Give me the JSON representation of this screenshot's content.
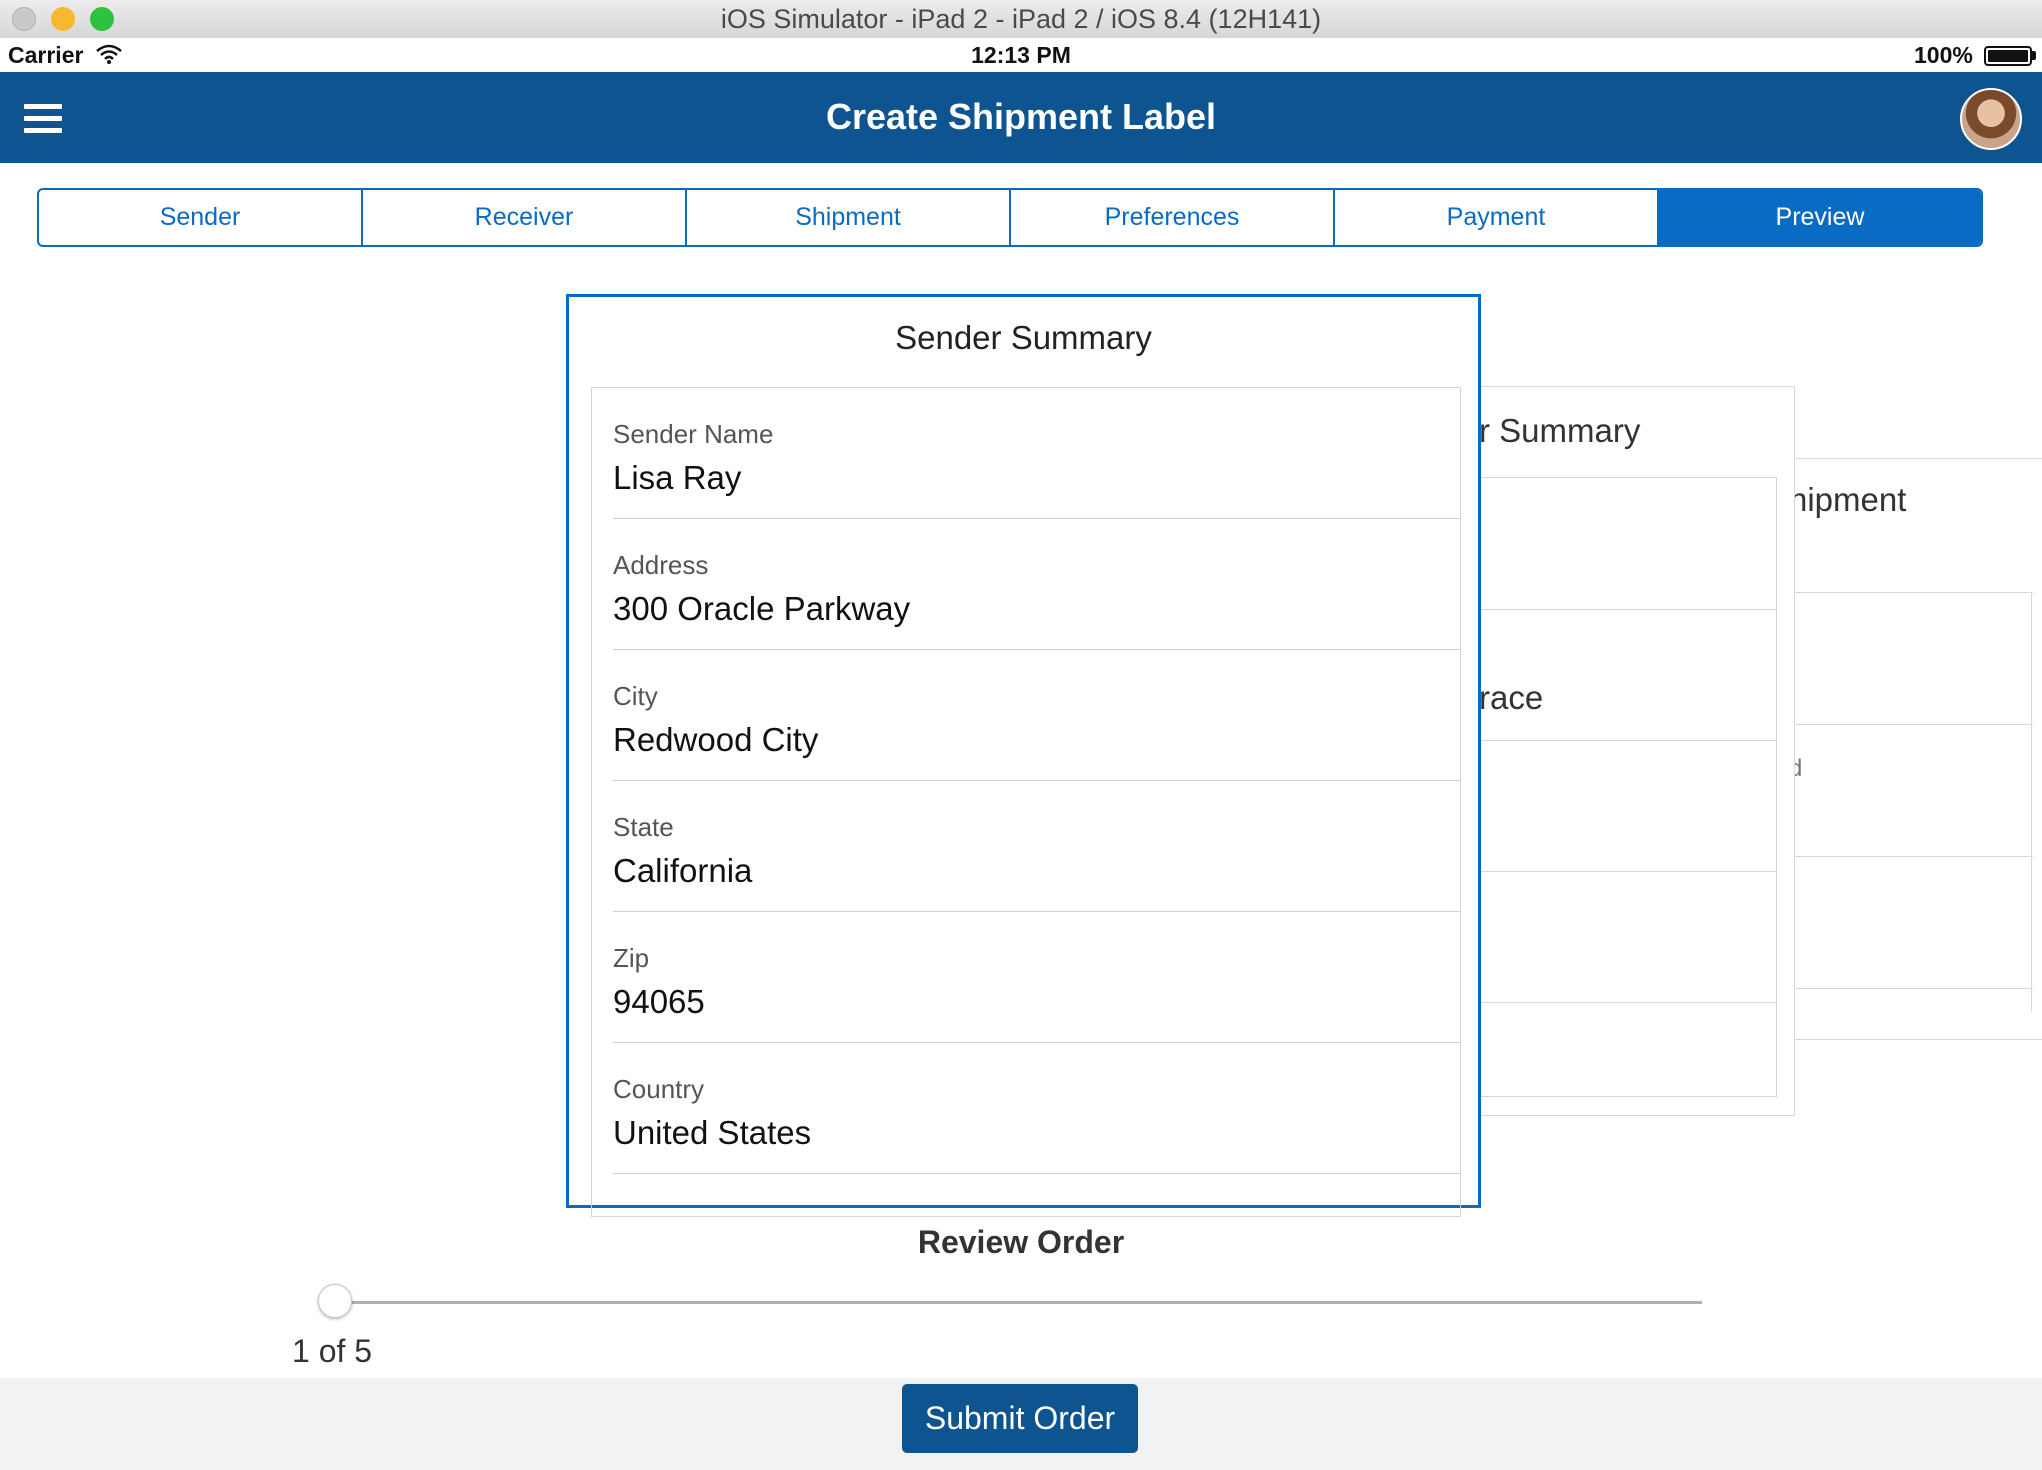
{
  "window": {
    "title": "iOS Simulator - iPad 2 - iPad 2 / iOS 8.4 (12H141)"
  },
  "status": {
    "carrier": "Carrier",
    "time": "12:13 PM",
    "battery": "100%"
  },
  "header": {
    "title": "Create Shipment Label"
  },
  "tabs": [
    {
      "label": "Sender"
    },
    {
      "label": "Receiver"
    },
    {
      "label": "Shipment"
    },
    {
      "label": "Preferences"
    },
    {
      "label": "Payment"
    },
    {
      "label": "Preview"
    }
  ],
  "front_card": {
    "title": "Sender Summary",
    "fields": [
      {
        "label": "Sender Name",
        "value": "Lisa Ray"
      },
      {
        "label": "Address",
        "value": "300 Oracle Parkway"
      },
      {
        "label": "City",
        "value": "Redwood City"
      },
      {
        "label": "State",
        "value": "California"
      },
      {
        "label": "Zip",
        "value": "94065"
      },
      {
        "label": "Country",
        "value": "United States"
      }
    ]
  },
  "back_card_1": {
    "title_fragment": "r Summary",
    "value_fragment": "race"
  },
  "back_card_2": {
    "title_fragment": "nipment",
    "value_fragment": "d"
  },
  "review": {
    "heading": "Review Order",
    "counter": "1 of 5",
    "progress": 0.0
  },
  "actions": {
    "submit_label": "Submit Order"
  },
  "colors": {
    "nav": "#0e5490",
    "accent": "#0a6bc4"
  }
}
